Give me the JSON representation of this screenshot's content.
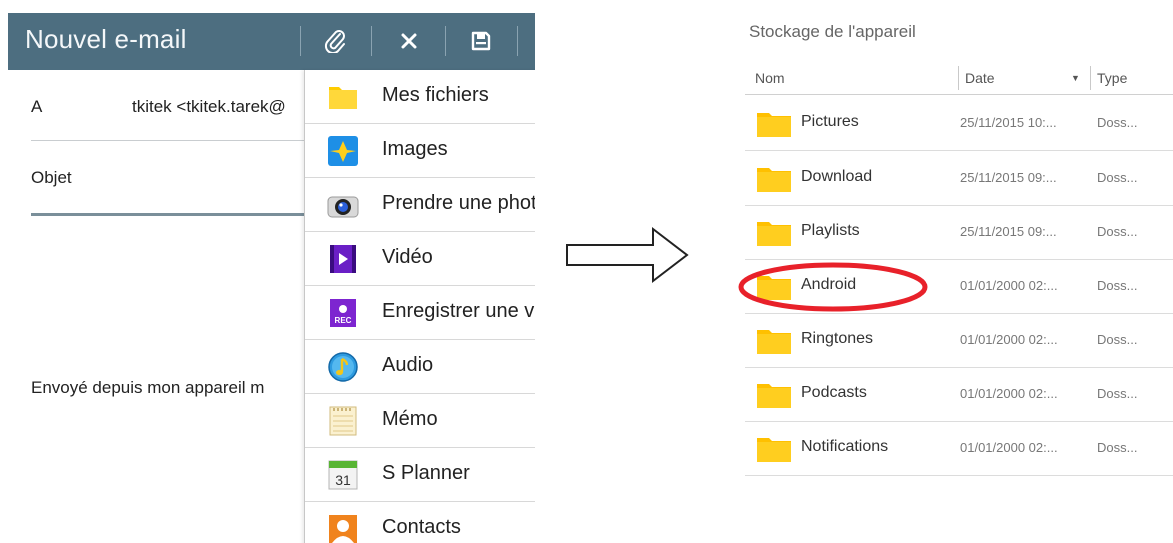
{
  "compose": {
    "title": "Nouvel e-mail",
    "to_label": "A",
    "to_value": "tkitek <tkitek.tarek@",
    "subject_label": "Objet",
    "signature": "Envoyé depuis mon appareil m"
  },
  "attach_menu": {
    "items": [
      {
        "label": "Mes fichiers",
        "icon": "folder-icon"
      },
      {
        "label": "Images",
        "icon": "gallery-icon"
      },
      {
        "label": "Prendre une photo",
        "icon": "camera-icon"
      },
      {
        "label": "Vidéo",
        "icon": "video-icon"
      },
      {
        "label": "Enregistrer une vidéo",
        "icon": "record-video-icon"
      },
      {
        "label": "Audio",
        "icon": "audio-icon"
      },
      {
        "label": "Mémo",
        "icon": "memo-icon"
      },
      {
        "label": "S Planner",
        "icon": "calendar-icon"
      },
      {
        "label": "Contacts",
        "icon": "contacts-icon"
      }
    ]
  },
  "browser": {
    "heading": "Stockage de l'appareil",
    "columns": [
      "Nom",
      "Date",
      "Type"
    ],
    "rows": [
      {
        "name": "Pictures",
        "date": "25/11/2015 10:...",
        "type": "Doss..."
      },
      {
        "name": "Download",
        "date": "25/11/2015 09:...",
        "type": "Doss..."
      },
      {
        "name": "Playlists",
        "date": "25/11/2015 09:...",
        "type": "Doss..."
      },
      {
        "name": "Android",
        "date": "01/01/2000 02:...",
        "type": "Doss...",
        "highlighted": true
      },
      {
        "name": "Ringtones",
        "date": "01/01/2000 02:...",
        "type": "Doss..."
      },
      {
        "name": "Podcasts",
        "date": "01/01/2000 02:...",
        "type": "Doss..."
      },
      {
        "name": "Notifications",
        "date": "01/01/2000 02:...",
        "type": "Doss..."
      }
    ]
  },
  "colors": {
    "appbar": "#4d6e80",
    "folder": "#ffcc00",
    "highlight": "#e8212a"
  }
}
